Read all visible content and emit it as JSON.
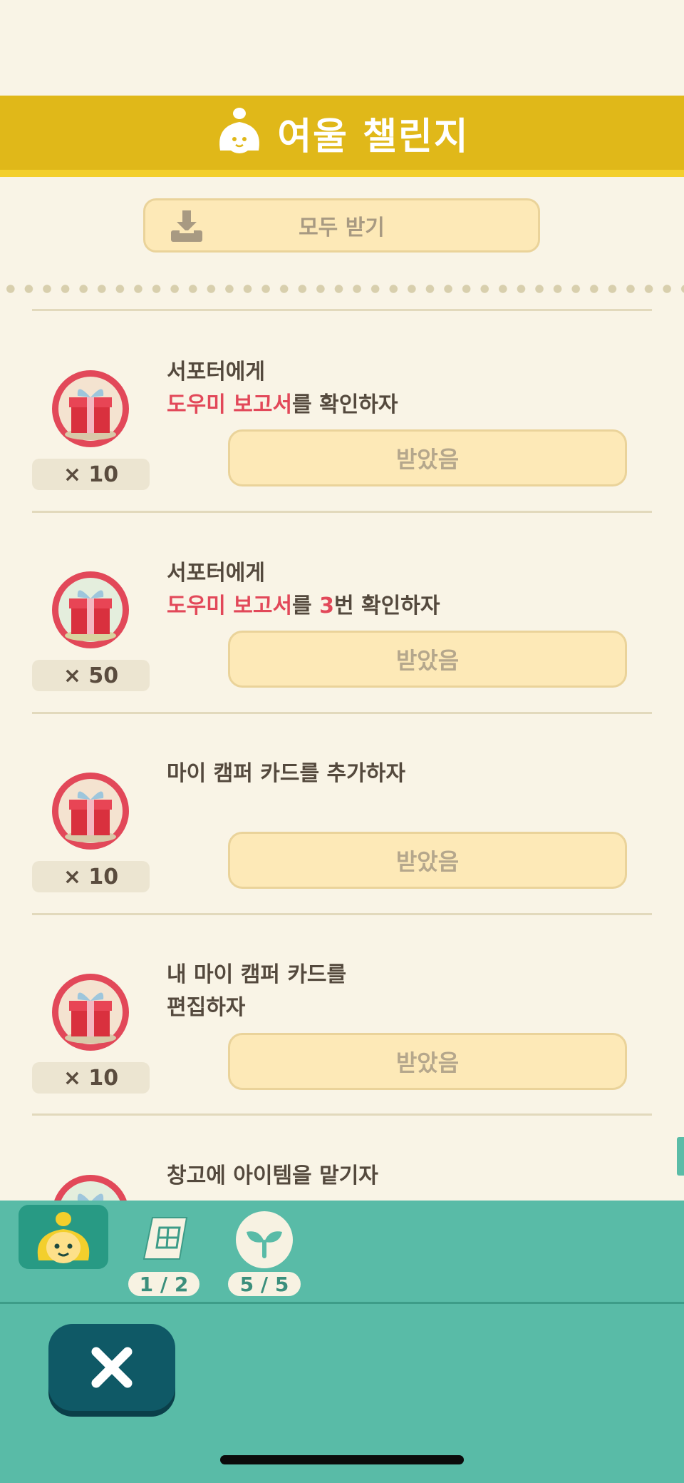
{
  "header": {
    "title": "여울 챌린지"
  },
  "claim_all": {
    "label": "모두 받기"
  },
  "tasks": [
    {
      "count": "× 10",
      "line1": "서포터에게",
      "line2_hl": "도우미 보고서",
      "line2_a": "를 ",
      "line2_num": "",
      "line2_rest": "확인하자",
      "button": "받았음"
    },
    {
      "count": "× 50",
      "line1": "서포터에게",
      "line2_hl": "도우미 보고서",
      "line2_a": "를 ",
      "line2_num": "3",
      "line2_rest": "번 확인하자",
      "button": "받았음"
    },
    {
      "count": "× 10",
      "line1": "마이 캠퍼 카드를 추가하자",
      "button": "받았음"
    },
    {
      "count": "× 10",
      "line1": "내 마이 캠퍼 카드를",
      "line2": "편집하자",
      "button": "받았음"
    },
    {
      "line1": "창고에 아이템을 맡기자"
    }
  ],
  "bottom_tabs": [
    {
      "icon": "isabelle-icon",
      "label": ""
    },
    {
      "icon": "calendar-icon",
      "label": "1 / 2"
    },
    {
      "icon": "sprout-icon",
      "label": "5 / 5"
    }
  ],
  "colors": {
    "banner": "#e0b819",
    "highlight": "#e24859",
    "teal": "#59bba7",
    "close": "#0f5966"
  }
}
